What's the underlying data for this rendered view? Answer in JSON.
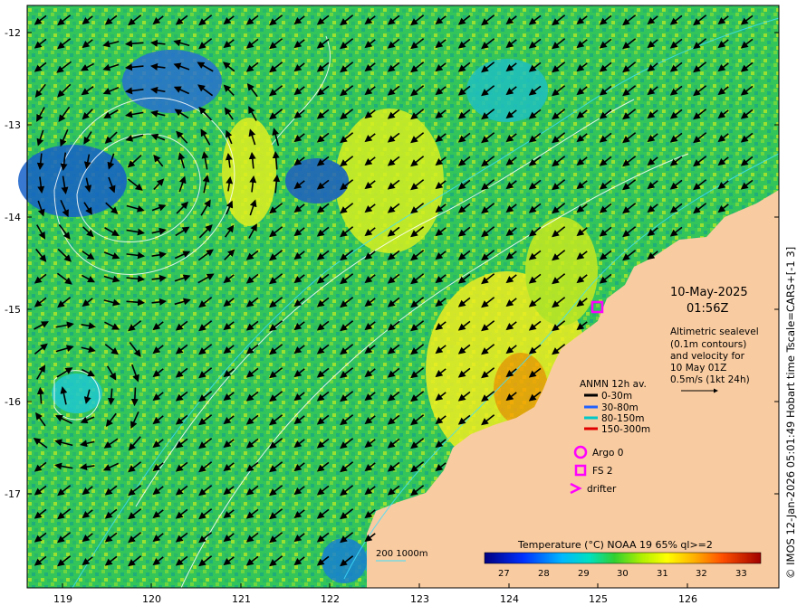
{
  "map": {
    "date": "10-May-2025",
    "time": "01:56Z",
    "description_lines": [
      "Altimetric sealevel",
      "(0.1m contours)",
      "and velocity for",
      "10 May 01Z",
      "0.5m/s (1kt 24h)"
    ],
    "y_ticks": [
      "-12",
      "-13",
      "-14",
      "-15",
      "-16",
      "-17"
    ],
    "x_ticks": [
      "119",
      "120",
      "121",
      "122",
      "123",
      "124",
      "125",
      "126"
    ],
    "legend": {
      "title": "ANMN 12h av.",
      "depths": [
        {
          "label": "0-30m",
          "color": "#000000"
        },
        {
          "label": "30-80m",
          "color": "#2060ff"
        },
        {
          "label": "80-150m",
          "color": "#00c8c8"
        },
        {
          "label": "150-300m",
          "color": "#e00000"
        }
      ],
      "argo": "Argo 0",
      "fs": "FS 2",
      "drifter": "drifter",
      "marker_color": "#ff00ff"
    },
    "contour_legend": "200  1000m",
    "colorbar": {
      "title": "Temperature (°C) NOAA 19 65% ql>=2",
      "ticks": [
        "27",
        "28",
        "29",
        "30",
        "31",
        "32",
        "33"
      ],
      "range": [
        26.5,
        33.5
      ]
    },
    "side_text": "© IMOS 12-Jan-2026 05:01:49 Hobart time Tscale=CARS+[-1 3]",
    "colors": {
      "land": "#f9cba0",
      "arrow": "#000000",
      "contour": "#ffffff",
      "isobath": "#40e0ff"
    }
  }
}
